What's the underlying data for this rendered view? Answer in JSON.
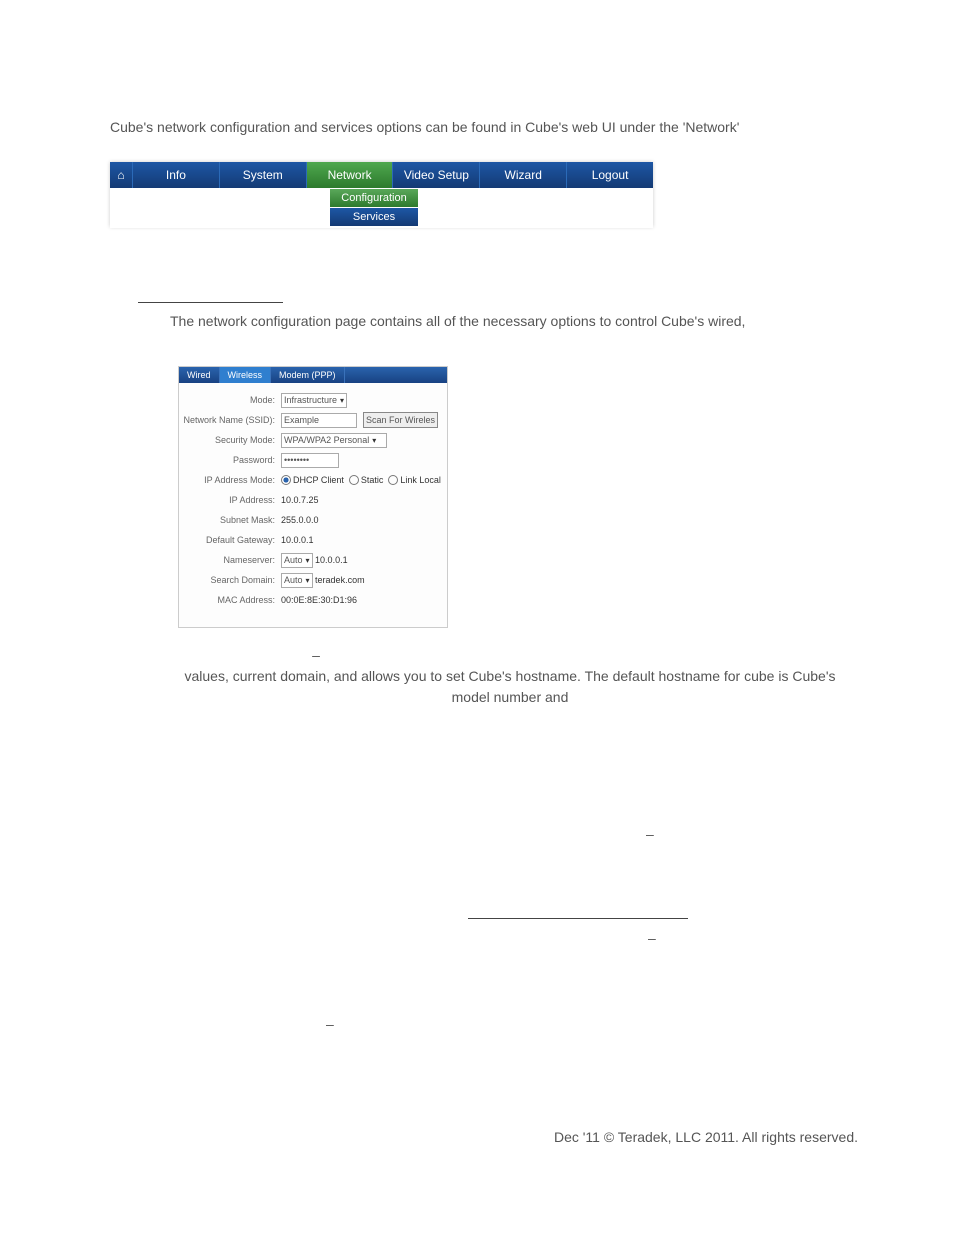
{
  "intro": "Cube's network configuration and services options can be found in Cube's web UI under the 'Network'",
  "nav": {
    "home_icon": "⌂",
    "items": [
      "Info",
      "System",
      "Network",
      "Video Setup",
      "Wizard",
      "Logout"
    ],
    "active": "Network",
    "sub": [
      "Configuration",
      "Services"
    ]
  },
  "netcfg_text": "The network configuration page contains all of the necessary options to control Cube's wired,",
  "panel": {
    "tabs": [
      "Wired",
      "Wireless",
      "Modem (PPP)"
    ],
    "active": "Wireless",
    "labels": {
      "mode": "Mode:",
      "ssid": "Network Name (SSID):",
      "security": "Security Mode:",
      "password": "Password:",
      "ipmode": "IP Address Mode:",
      "ip": "IP Address:",
      "mask": "Subnet Mask:",
      "gw": "Default Gateway:",
      "ns": "Nameserver:",
      "sd": "Search Domain:",
      "mac": "MAC Address:"
    },
    "mode": "Infrastructure",
    "ssid": "Example",
    "scan": "Scan For Wireles",
    "security": "WPA/WPA2 Personal",
    "password": "••••••••",
    "ipmode": {
      "opts": [
        "DHCP Client",
        "Static",
        "Link Local"
      ],
      "selected": "DHCP Client"
    },
    "ip": "10.0.7.25",
    "mask": "255.0.0.0",
    "gw": "10.0.0.1",
    "ns_mode": "Auto",
    "ns_val": "10.0.0.1",
    "sd_mode": "Auto",
    "sd_val": "teradek.com",
    "mac": "00:0E:8E:30:D1:96"
  },
  "dash": "–",
  "vals_text": "values, current domain, and allows you to set Cube's hostname. The default hostname for cube is Cube's model number and",
  "footer": "Dec '11 © Teradek, LLC 2011. All rights reserved."
}
